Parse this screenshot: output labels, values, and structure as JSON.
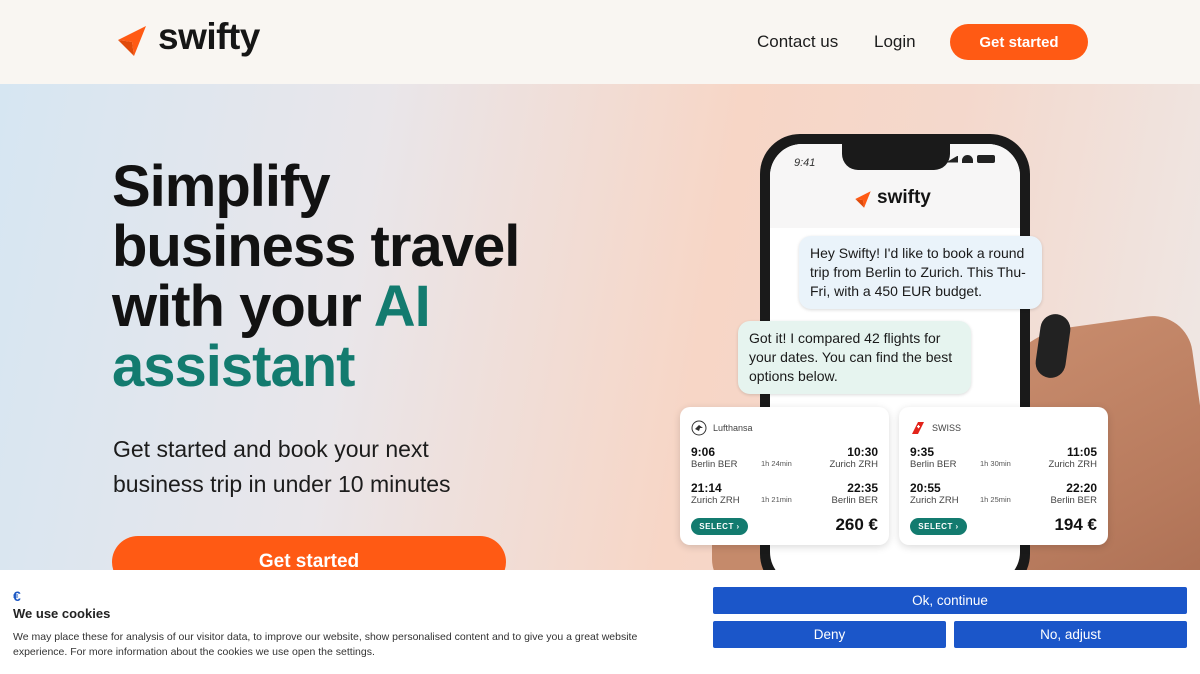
{
  "brand": {
    "name": "swifty",
    "logo_icon": "swifty-bolt-icon",
    "color": "#ff5a14",
    "accent": "#137b6f"
  },
  "nav": {
    "contact_label": "Contact us",
    "login_label": "Login",
    "cta_label": "Get started"
  },
  "hero": {
    "headline_1": "Simplify",
    "headline_2": "business travel",
    "headline_3": "with your ",
    "headline_accent_1": "AI",
    "headline_accent_2": "assistant",
    "subhead": "Get started and book your next business trip in under 10 minutes",
    "cta_label": "Get started"
  },
  "phone": {
    "time": "9:41",
    "app_name": "swifty",
    "user_message": "Hey Swifty! I'd like to book a round trip from Berlin to Zurich. This Thu-Fri, with a 450 EUR budget.",
    "ai_message": "Got it! I compared 42 flights for your dates. You can find the best options below."
  },
  "flights": [
    {
      "airline": "Lufthansa",
      "outbound": {
        "dep_time": "9:06",
        "dep_city": "Berlin BER",
        "duration": "1h 24min",
        "arr_time": "10:30",
        "arr_city": "Zurich ZRH"
      },
      "inbound": {
        "dep_time": "21:14",
        "dep_city": "Zurich ZRH",
        "duration": "1h 21min",
        "arr_time": "22:35",
        "arr_city": "Berlin BER"
      },
      "select_label": "SELECT ›",
      "price": "260 €"
    },
    {
      "airline": "SWISS",
      "outbound": {
        "dep_time": "9:35",
        "dep_city": "Berlin BER",
        "duration": "1h 30min",
        "arr_time": "11:05",
        "arr_city": "Zurich ZRH"
      },
      "inbound": {
        "dep_time": "20:55",
        "dep_city": "Zurich ZRH",
        "duration": "1h 25min",
        "arr_time": "22:20",
        "arr_city": "Berlin BER"
      },
      "select_label": "SELECT ›",
      "price": "194 €"
    }
  ],
  "cookies": {
    "title": "We use cookies",
    "text": "We may place these for analysis of our visitor data, to improve our website, show personalised content and to give you a great website experience. For more information about the cookies we use open the settings.",
    "ok_label": "Ok, continue",
    "deny_label": "Deny",
    "adjust_label": "No, adjust",
    "button_color": "#1b56c9"
  }
}
